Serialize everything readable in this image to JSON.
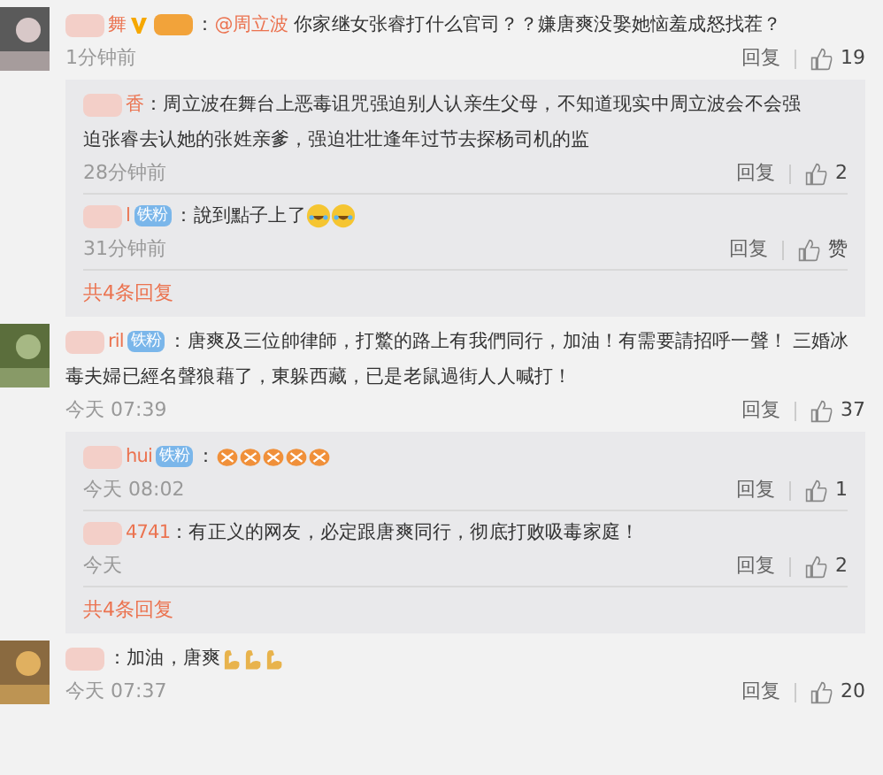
{
  "comments": [
    {
      "name": "舞",
      "verified": true,
      "badge": {
        "kind": "gold"
      },
      "sep": "：",
      "mention": "@周立波",
      "text": "你家继女张睿打什么官司？？嫌唐爽没娶她恼羞成怒找茬？",
      "time": "1分钟前",
      "reply": "回复",
      "likes": "19",
      "replies": [
        {
          "name": "香",
          "sep": "：",
          "text": "周立波在舞台上恶毒诅咒强迫别人认亲生父母，不知道现实中周立波会不会强",
          "text_line_2": "迫张睿去认她的张姓亲爹，强迫壮壮逢年过节去探杨司机的监",
          "time": "28分钟前",
          "reply": "回复",
          "likes": "2"
        },
        {
          "name": "l",
          "badge": {
            "kind": "blue",
            "text": "铁粉"
          },
          "sep": "：",
          "text": "說到點子上了",
          "emojis": [
            {
              "kind": "laugh"
            },
            {
              "kind": "laugh"
            }
          ],
          "time": "31分钟前",
          "reply": "回复",
          "likes": "赞"
        }
      ],
      "more": "共4条回复"
    },
    {
      "name": "ril",
      "badge": {
        "kind": "blue",
        "text": "铁粉"
      },
      "sep": "：",
      "text": "唐爽及三位帥律師，打鱉的路上有我們同行，加油！有需要請招呼一聲！ 三婚冰",
      "text_line_2": "毒夫婦已經名聲狼藉了，東躲西藏，已是老鼠過街人人喊打！",
      "time": "今天 07:39",
      "reply": "回复",
      "likes": "37",
      "replies": [
        {
          "name": "hui",
          "badge": {
            "kind": "blue",
            "text": "铁粉"
          },
          "sep": "：",
          "emojis": [
            {
              "kind": "clap"
            },
            {
              "kind": "clap"
            },
            {
              "kind": "clap"
            },
            {
              "kind": "clap"
            },
            {
              "kind": "clap"
            }
          ],
          "time": "今天 08:02",
          "reply": "回复",
          "likes": "1"
        },
        {
          "name": "4741",
          "sep": "：",
          "text": "有正义的网友，必定跟唐爽同行，彻底打败吸毒家庭！",
          "time": "今天",
          "reply": "回复",
          "likes": "2"
        }
      ],
      "more": "共4条回复"
    },
    {
      "sep": "：",
      "text": "加油，唐爽",
      "emojis": [
        {
          "kind": "arm"
        },
        {
          "kind": "arm"
        },
        {
          "kind": "arm"
        }
      ],
      "time": "今天 07:37",
      "reply": "回复",
      "likes": "20"
    }
  ]
}
